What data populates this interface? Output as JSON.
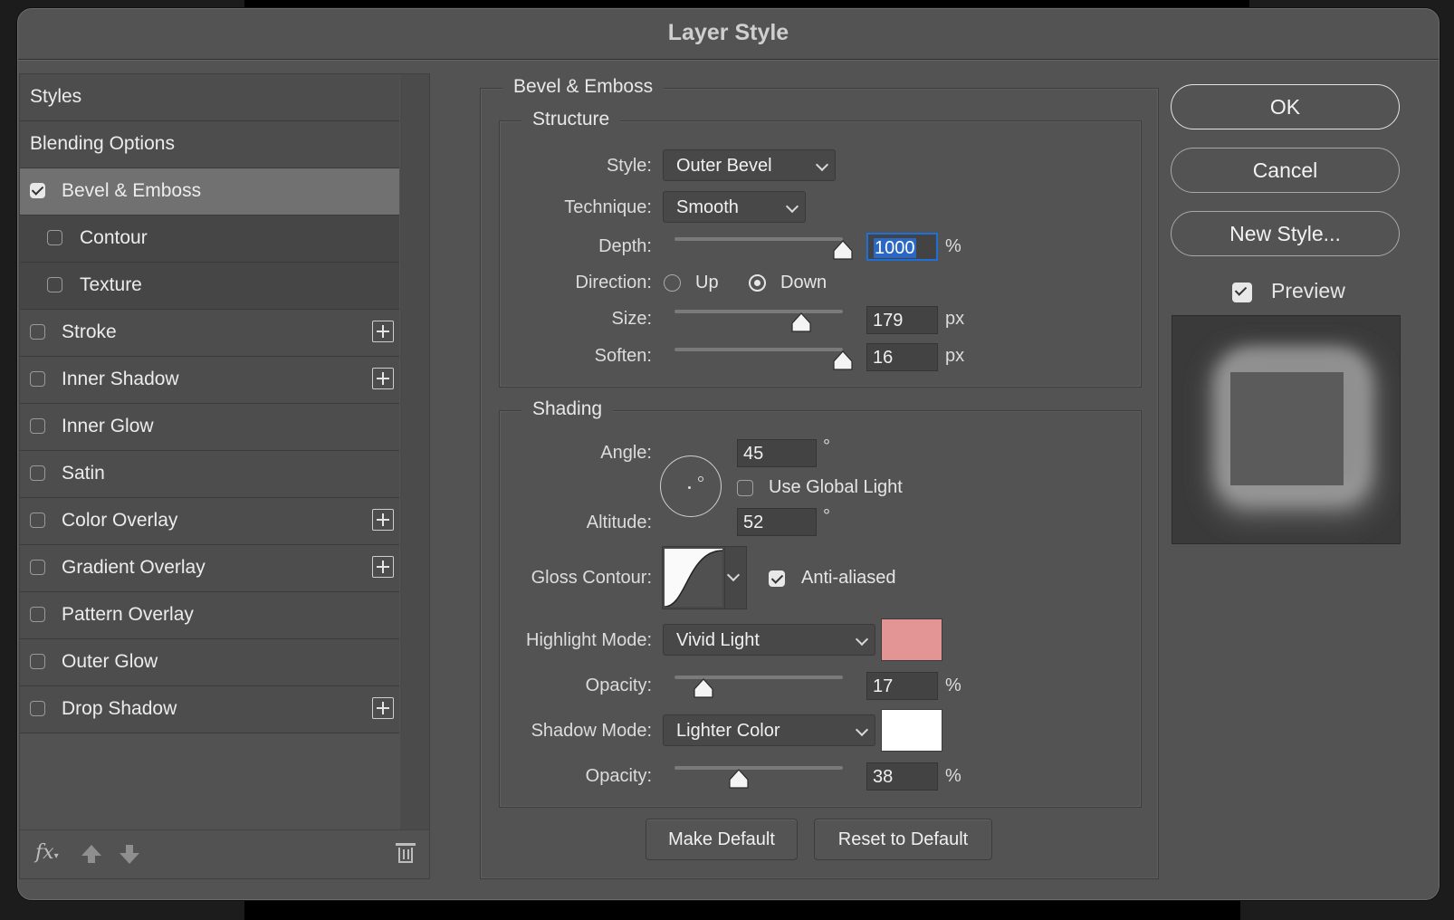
{
  "dialog": {
    "title": "Layer Style"
  },
  "styles_list": {
    "items": [
      {
        "label": "Styles",
        "checkbox": false,
        "checked": false,
        "plus": false,
        "type": "plain"
      },
      {
        "label": "Blending Options",
        "checkbox": false,
        "checked": false,
        "plus": false,
        "type": "plain"
      },
      {
        "label": "Bevel & Emboss",
        "checkbox": true,
        "checked": true,
        "plus": false,
        "type": "selected"
      },
      {
        "label": "Contour",
        "checkbox": true,
        "checked": false,
        "plus": false,
        "type": "sub"
      },
      {
        "label": "Texture",
        "checkbox": true,
        "checked": false,
        "plus": false,
        "type": "sub"
      },
      {
        "label": "Stroke",
        "checkbox": true,
        "checked": false,
        "plus": true,
        "type": "normal"
      },
      {
        "label": "Inner Shadow",
        "checkbox": true,
        "checked": false,
        "plus": true,
        "type": "normal"
      },
      {
        "label": "Inner Glow",
        "checkbox": true,
        "checked": false,
        "plus": false,
        "type": "normal"
      },
      {
        "label": "Satin",
        "checkbox": true,
        "checked": false,
        "plus": false,
        "type": "normal"
      },
      {
        "label": "Color Overlay",
        "checkbox": true,
        "checked": false,
        "plus": true,
        "type": "normal"
      },
      {
        "label": "Gradient Overlay",
        "checkbox": true,
        "checked": false,
        "plus": true,
        "type": "normal"
      },
      {
        "label": "Pattern Overlay",
        "checkbox": true,
        "checked": false,
        "plus": false,
        "type": "normal"
      },
      {
        "label": "Outer Glow",
        "checkbox": true,
        "checked": false,
        "plus": false,
        "type": "normal"
      },
      {
        "label": "Drop Shadow",
        "checkbox": true,
        "checked": false,
        "plus": true,
        "type": "normal"
      }
    ],
    "footer": {
      "fx_label": "fx"
    }
  },
  "bevel": {
    "section_title": "Bevel & Emboss",
    "structure": {
      "title": "Structure",
      "style_label": "Style:",
      "style_value": "Outer Bevel",
      "technique_label": "Technique:",
      "technique_value": "Smooth",
      "depth_label": "Depth:",
      "depth_value": "1000",
      "depth_unit": "%",
      "depth_slider": 1.0,
      "direction_label": "Direction:",
      "direction_up": "Up",
      "direction_down": "Down",
      "direction_selected": "Down",
      "size_label": "Size:",
      "size_value": "179",
      "size_unit": "px",
      "size_slider": 0.75,
      "soften_label": "Soften:",
      "soften_value": "16",
      "soften_unit": "px",
      "soften_slider": 1.0
    },
    "shading": {
      "title": "Shading",
      "angle_label": "Angle:",
      "angle_value": "45",
      "angle_unit": "°",
      "use_global_light_label": "Use Global Light",
      "use_global_light": false,
      "altitude_label": "Altitude:",
      "altitude_value": "52",
      "altitude_unit": "°",
      "gloss_contour_label": "Gloss Contour:",
      "anti_aliased_label": "Anti-aliased",
      "anti_aliased": true,
      "highlight_mode_label": "Highlight Mode:",
      "highlight_mode_value": "Vivid Light",
      "highlight_color": "#e39595",
      "highlight_opacity_label": "Opacity:",
      "highlight_opacity_value": "17",
      "highlight_opacity_unit": "%",
      "highlight_opacity_slider": 0.17,
      "shadow_mode_label": "Shadow Mode:",
      "shadow_mode_value": "Lighter Color",
      "shadow_color": "#ffffff",
      "shadow_opacity_label": "Opacity:",
      "shadow_opacity_value": "38",
      "shadow_opacity_unit": "%",
      "shadow_opacity_slider": 0.38
    },
    "make_default_label": "Make Default",
    "reset_default_label": "Reset to Default"
  },
  "actions": {
    "ok_label": "OK",
    "cancel_label": "Cancel",
    "new_style_label": "New Style...",
    "preview_label": "Preview",
    "preview_checked": true
  }
}
